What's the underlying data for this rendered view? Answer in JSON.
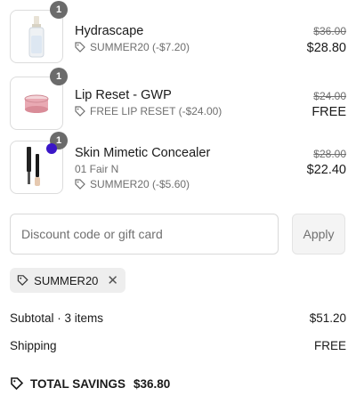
{
  "items": [
    {
      "name": "Hydrascape",
      "quantity": "1",
      "variant": "",
      "discount": "SUMMER20 (-$7.20)",
      "original_price": "$36.00",
      "final_price": "$28.80"
    },
    {
      "name": "Lip Reset - GWP",
      "quantity": "1",
      "variant": "",
      "discount": "FREE LIP RESET (-$24.00)",
      "original_price": "$24.00",
      "final_price": "FREE"
    },
    {
      "name": "Skin Mimetic Concealer",
      "quantity": "1",
      "variant": "01 Fair N",
      "discount": "SUMMER20 (-$5.60)",
      "original_price": "$28.00",
      "final_price": "$22.40"
    }
  ],
  "discount_form": {
    "placeholder": "Discount code or gift card",
    "value": "",
    "apply_label": "Apply"
  },
  "applied_code": {
    "code": "SUMMER20"
  },
  "summary": {
    "subtotal_label": "Subtotal · 3 items",
    "subtotal_value": "$51.20",
    "shipping_label": "Shipping",
    "shipping_value": "FREE",
    "savings_label": "TOTAL SAVINGS",
    "savings_value": "$36.80"
  },
  "colors": {
    "badge": "#6b6b6b",
    "swatch": "#3a16c8"
  }
}
